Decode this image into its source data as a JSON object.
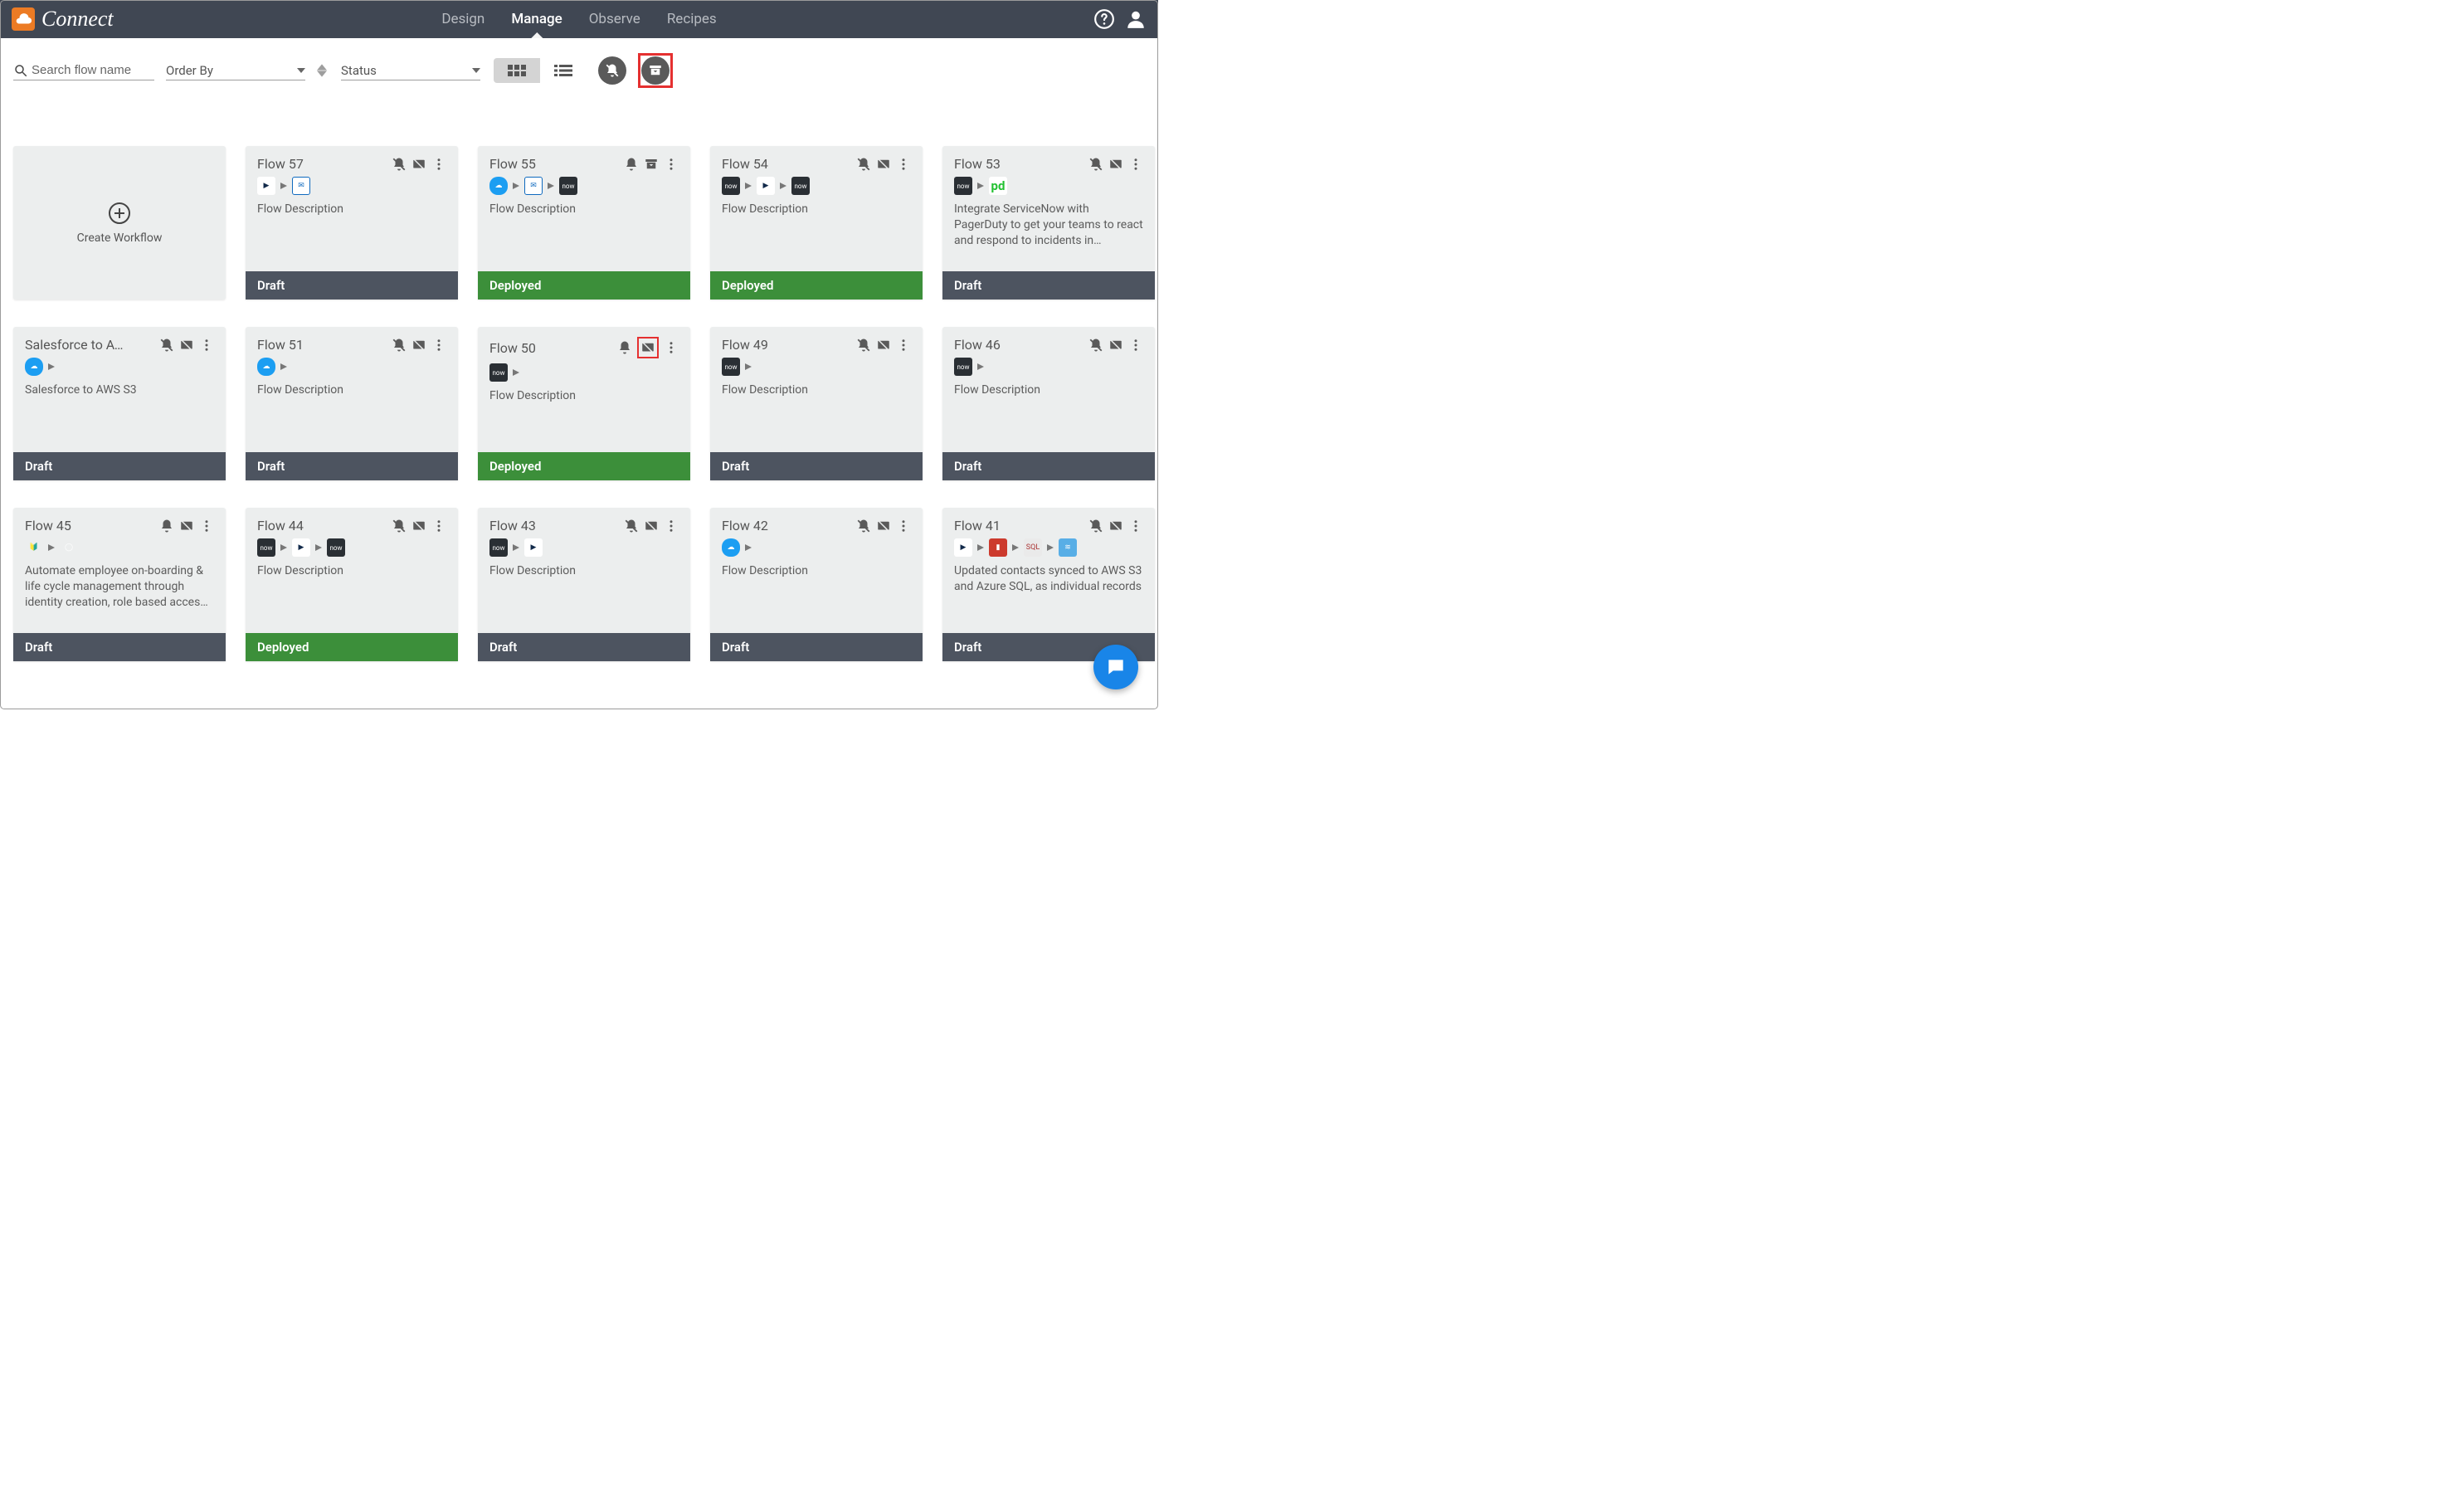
{
  "app": {
    "brand": "Connect"
  },
  "nav": {
    "tabs": [
      "Design",
      "Manage",
      "Observe",
      "Recipes"
    ],
    "activeIndex": 1
  },
  "toolbar": {
    "searchPlaceholder": "Search flow name",
    "orderByLabel": "Order By",
    "statusLabel": "Status"
  },
  "create": {
    "label": "Create Workflow"
  },
  "cards": [
    {
      "title": "Flow 57",
      "desc": "Flow Description",
      "status": "Draft",
      "bellOff": true,
      "archive": false,
      "glyphs": [
        "triangle",
        "outlook"
      ]
    },
    {
      "title": "Flow 55",
      "desc": "Flow Description",
      "status": "Deployed",
      "bellOff": false,
      "archive": true,
      "glyphs": [
        "cloud",
        "outlook",
        "now"
      ]
    },
    {
      "title": "Flow 54",
      "desc": "Flow Description",
      "status": "Deployed",
      "bellOff": true,
      "archive": false,
      "glyphs": [
        "now",
        "triangle",
        "now"
      ]
    },
    {
      "title": "Flow 53",
      "desc": "Integrate ServiceNow with PagerDuty to get your teams to react and respond to incidents in…",
      "status": "Draft",
      "bellOff": true,
      "archive": false,
      "glyphs": [
        "now",
        "pd"
      ]
    },
    {
      "title": "Salesforce to AWS…",
      "desc": "Salesforce to AWS S3",
      "status": "Draft",
      "bellOff": true,
      "archive": false,
      "glyphs": [
        "cloud"
      ]
    },
    {
      "title": "Flow 51",
      "desc": "Flow Description",
      "status": "Draft",
      "bellOff": true,
      "archive": false,
      "glyphs": [
        "cloud"
      ]
    },
    {
      "title": "Flow 50",
      "desc": "Flow Description",
      "status": "Deployed",
      "bellOff": false,
      "archive": false,
      "highlightSecondIcon": true,
      "glyphs": [
        "now"
      ]
    },
    {
      "title": "Flow 49",
      "desc": "Flow Description",
      "status": "Draft",
      "bellOff": true,
      "archive": false,
      "glyphs": [
        "now"
      ]
    },
    {
      "title": "Flow 46",
      "desc": "Flow Description",
      "status": "Draft",
      "bellOff": true,
      "archive": false,
      "glyphs": [
        "now"
      ]
    },
    {
      "title": "Flow 45",
      "desc": "Automate employee on-boarding & life cycle management through identity creation, role based acces…",
      "status": "Draft",
      "bellOff": false,
      "archive": false,
      "glyphs": [
        "green",
        "circle"
      ]
    },
    {
      "title": "Flow 44",
      "desc": "Flow Description",
      "status": "Deployed",
      "bellOff": true,
      "archive": false,
      "glyphs": [
        "now",
        "triangle",
        "now"
      ]
    },
    {
      "title": "Flow 43",
      "desc": "Flow Description",
      "status": "Draft",
      "bellOff": true,
      "archive": false,
      "glyphs": [
        "now",
        "triangle"
      ]
    },
    {
      "title": "Flow 42",
      "desc": "Flow Description",
      "status": "Draft",
      "bellOff": true,
      "archive": false,
      "glyphs": [
        "cloud"
      ]
    },
    {
      "title": "Flow 41",
      "desc": "Updated contacts synced to AWS S3 and Azure SQL, as individual records",
      "status": "Draft",
      "bellOff": true,
      "archive": false,
      "glyphs": [
        "triangle",
        "red",
        "sql",
        "aws"
      ]
    }
  ],
  "statusLabels": {
    "Draft": "Draft",
    "Deployed": "Deployed"
  }
}
